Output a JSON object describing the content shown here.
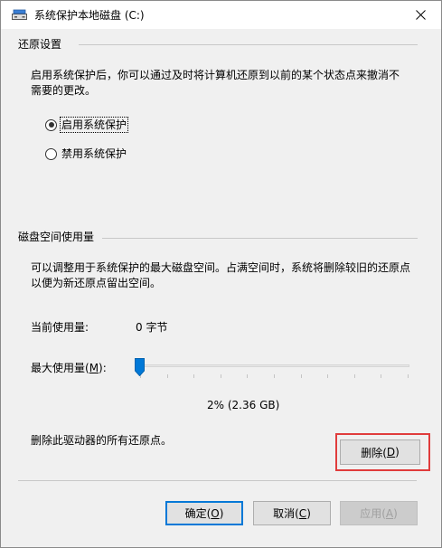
{
  "window": {
    "title": "系统保护本地磁盘 (C:)",
    "close_icon": "close-icon",
    "drive_icon": "drive-icon"
  },
  "restore_settings": {
    "group_title": "还原设置",
    "description": "启用系统保护后，你可以通过及时将计算机还原到以前的某个状态点来撤消不需要的更改。",
    "options": [
      {
        "label": "启用系统保护",
        "selected": true
      },
      {
        "label": "禁用系统保护",
        "selected": false
      }
    ]
  },
  "disk_space": {
    "group_title": "磁盘空间使用量",
    "description": "可以调整用于系统保护的最大磁盘空间。占满空间时，系统将删除较旧的还原点以便为新还原点留出空间。",
    "current_usage_label": "当前使用量:",
    "current_usage_value": "0 字节",
    "max_usage_label_prefix": "最大使用量(",
    "max_usage_label_key": "M",
    "max_usage_label_suffix": "):",
    "max_usage_value_percent": 2,
    "max_usage_readout": "2% (2.36 GB)",
    "delete_text": "删除此驱动器的所有还原点。",
    "delete_button_label": "删除(",
    "delete_button_key": "D",
    "delete_button_suffix": ")"
  },
  "footer": {
    "ok_label": "确定(",
    "ok_key": "O",
    "ok_suffix": ")",
    "cancel_label": "取消(",
    "cancel_key": "C",
    "cancel_suffix": ")",
    "apply_label": "应用(",
    "apply_key": "A",
    "apply_suffix": ")"
  },
  "colors": {
    "accent": "#0078d7",
    "highlight": "#e03c3c"
  }
}
